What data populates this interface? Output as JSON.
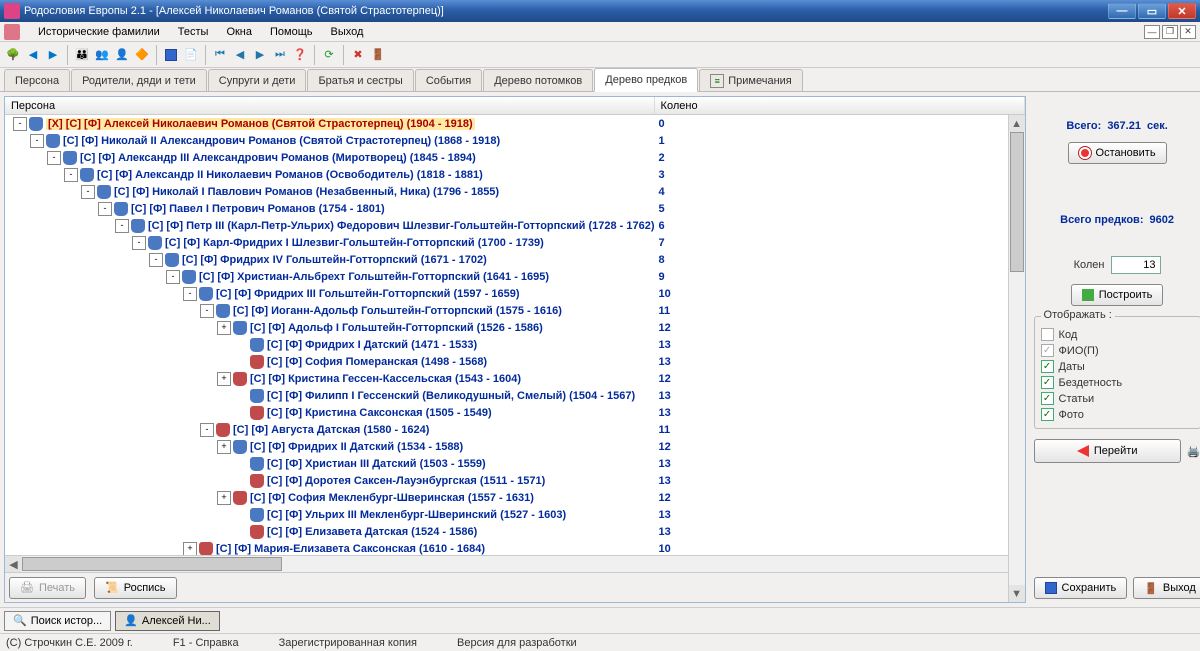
{
  "title": "Родословия Европы 2.1 - [Алексей Николаевич Романов (Святой Страстотерпец)]",
  "menu": [
    "Исторические фамилии",
    "Тесты",
    "Окна",
    "Помощь",
    "Выход"
  ],
  "tabs": [
    {
      "label": "Персона"
    },
    {
      "label": "Родители, дяди и тети"
    },
    {
      "label": "Супруги и дети"
    },
    {
      "label": "Братья и сестры"
    },
    {
      "label": "События"
    },
    {
      "label": "Дерево потомков"
    },
    {
      "label": "Дерево предков",
      "active": true
    },
    {
      "label": "Примечания",
      "icon": true
    }
  ],
  "tree_headers": {
    "persona": "Персона",
    "koleno": "Колено"
  },
  "tree": [
    {
      "d": 0,
      "t": "-",
      "g": "m",
      "sel": true,
      "n": "[X] [С] [Ф] Алексей Николаевич Романов (Святой Страстотерпец) (1904 - 1918)",
      "k": "0"
    },
    {
      "d": 1,
      "t": "-",
      "g": "m",
      "n": "[С] [Ф] Николай II Александрович Романов (Святой Страстотерпец) (1868 - 1918)",
      "k": "1"
    },
    {
      "d": 2,
      "t": "-",
      "g": "m",
      "n": "[С] [Ф] Александр III Александрович Романов (Миротворец) (1845 - 1894)",
      "k": "2"
    },
    {
      "d": 3,
      "t": "-",
      "g": "m",
      "n": "[С] [Ф] Александр II Николаевич Романов (Освободитель) (1818 - 1881)",
      "k": "3"
    },
    {
      "d": 4,
      "t": "-",
      "g": "m",
      "n": "[С] [Ф] Николай I Павлович Романов (Незабвенный, Ника) (1796 - 1855)",
      "k": "4"
    },
    {
      "d": 5,
      "t": "-",
      "g": "m",
      "n": "[С] [Ф] Павел I Петрович Романов (1754 - 1801)",
      "k": "5"
    },
    {
      "d": 6,
      "t": "-",
      "g": "m",
      "n": "[С] [Ф] Петр III (Карл-Петр-Ульрих) Федорович Шлезвиг-Гольштейн-Готторпский (1728 - 1762)",
      "k": "6"
    },
    {
      "d": 7,
      "t": "-",
      "g": "m",
      "n": "[С] [Ф] Карл-Фридрих I  Шлезвиг-Гольштейн-Готторпский (1700 - 1739)",
      "k": "7"
    },
    {
      "d": 8,
      "t": "-",
      "g": "m",
      "n": "[С] [Ф] Фридрих IV  Гольштейн-Готторпский (1671 - 1702)",
      "k": "8"
    },
    {
      "d": 9,
      "t": "-",
      "g": "m",
      "n": "[С] [Ф] Христиан-Альбрехт  Гольштейн-Готторпский (1641 - 1695)",
      "k": "9"
    },
    {
      "d": 10,
      "t": "-",
      "g": "m",
      "n": "[С] [Ф] Фридрих III  Гольштейн-Готторпский (1597 - 1659)",
      "k": "10"
    },
    {
      "d": 11,
      "t": "-",
      "g": "m",
      "n": "[С] [Ф] Иоганн-Адольф  Гольштейн-Готторпский (1575 - 1616)",
      "k": "11"
    },
    {
      "d": 12,
      "t": "+",
      "g": "m",
      "n": "[С] [Ф] Адольф I  Гольштейн-Готторпский (1526 - 1586)",
      "k": "12"
    },
    {
      "d": 13,
      "t": "",
      "g": "m",
      "n": "[С] [Ф] Фридрих I  Датский (1471 - 1533)",
      "k": "13"
    },
    {
      "d": 13,
      "t": "",
      "g": "f",
      "n": "[С] [Ф] София  Померанская (1498 - 1568)",
      "k": "13"
    },
    {
      "d": 12,
      "t": "+",
      "g": "f",
      "n": "[С] [Ф] Кристина  Гессен-Кассельская (1543 - 1604)",
      "k": "12"
    },
    {
      "d": 13,
      "t": "",
      "g": "m",
      "n": "[С] [Ф] Филипп I  Гессенский (Великодушный, Смелый) (1504 - 1567)",
      "k": "13"
    },
    {
      "d": 13,
      "t": "",
      "g": "f",
      "n": "[С] [Ф] Кристина  Саксонская (1505 - 1549)",
      "k": "13"
    },
    {
      "d": 11,
      "t": "-",
      "g": "f",
      "n": "[С] [Ф] Августа  Датская (1580 - 1624)",
      "k": "11"
    },
    {
      "d": 12,
      "t": "+",
      "g": "m",
      "n": "[С] [Ф] Фридрих II  Датский (1534 - 1588)",
      "k": "12"
    },
    {
      "d": 13,
      "t": "",
      "g": "m",
      "n": "[С] [Ф] Христиан III  Датский (1503 - 1559)",
      "k": "13"
    },
    {
      "d": 13,
      "t": "",
      "g": "f",
      "n": "[С] [Ф] Доротея  Саксен-Лауэнбургская (1511 - 1571)",
      "k": "13"
    },
    {
      "d": 12,
      "t": "+",
      "g": "f",
      "n": "[С] [Ф] София  Мекленбург-Шверинская (1557 - 1631)",
      "k": "12"
    },
    {
      "d": 13,
      "t": "",
      "g": "m",
      "n": "[С] [Ф] Ульрих III  Мекленбург-Шверинский (1527 - 1603)",
      "k": "13"
    },
    {
      "d": 13,
      "t": "",
      "g": "f",
      "n": "[С] [Ф] Елизавета  Датская (1524 - 1586)",
      "k": "13"
    },
    {
      "d": 10,
      "t": "+",
      "g": "f",
      "n": "[С] [Ф] Мария-Елизавета  Саксонская (1610 - 1684)",
      "k": "10"
    }
  ],
  "left_buttons": {
    "print": "Печать",
    "rospis": "Роспись"
  },
  "right": {
    "total_label": "Всего:",
    "total_val": "367.21",
    "sec": "сек.",
    "stop": "Остановить",
    "ancestors_label": "Всего предков:",
    "ancestors_val": "9602",
    "kolen_label": "Колен",
    "kolen_val": "13",
    "build": "Построить",
    "display": "Отображать :",
    "opts": [
      {
        "l": "Код",
        "c": false,
        "dis": true
      },
      {
        "l": "ФИО(П)",
        "c": true,
        "dis": true
      },
      {
        "l": "Даты",
        "c": true
      },
      {
        "l": "Бездетность",
        "c": true
      },
      {
        "l": "Статьи",
        "c": true
      },
      {
        "l": "Фото",
        "c": true
      }
    ],
    "goto": "Перейти",
    "save": "Сохранить",
    "exit": "Выход"
  },
  "task": {
    "search": "Поиск истор...",
    "person": "Алексей Ни..."
  },
  "status": {
    "c": "(С) Строчкин С.Е. 2009 г.",
    "f1": "F1 - Справка",
    "reg": "Зарегистрированная копия",
    "ver": "Версия для разработки"
  }
}
